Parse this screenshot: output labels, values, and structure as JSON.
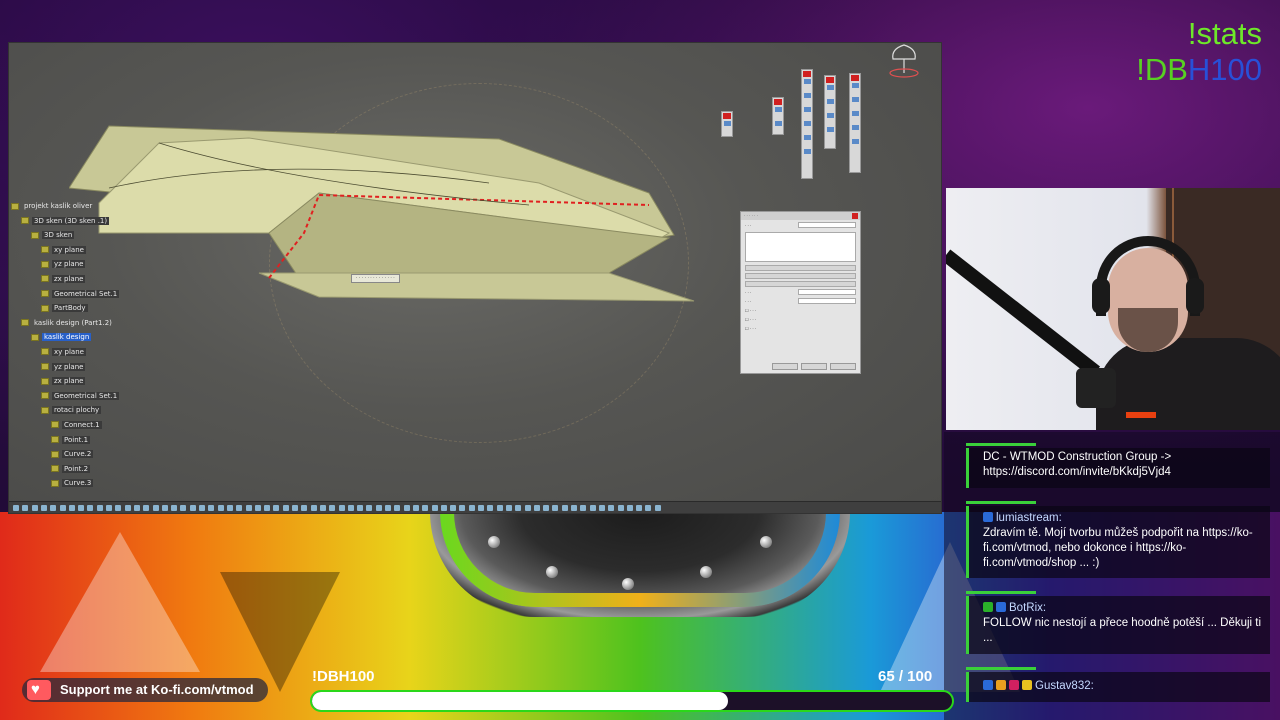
{
  "overlay": {
    "stats_line1": "!stats",
    "stats_line2_prefix": "!DB",
    "stats_line2_suffix": "H100"
  },
  "cad": {
    "tree": [
      {
        "label": "projekt kaslik oliver",
        "indent": 0,
        "style": "plain"
      },
      {
        "label": "3D sken  (3D sken .1)",
        "indent": 1,
        "style": "dark"
      },
      {
        "label": "3D sken",
        "indent": 2,
        "style": "dark"
      },
      {
        "label": "xy plane",
        "indent": 3,
        "style": "dark"
      },
      {
        "label": "yz plane",
        "indent": 3,
        "style": "dark"
      },
      {
        "label": "zx plane",
        "indent": 3,
        "style": "dark"
      },
      {
        "label": "Geometrical Set.1",
        "indent": 3,
        "style": "dark"
      },
      {
        "label": "PartBody",
        "indent": 3,
        "style": "dark"
      },
      {
        "label": "kaslik design (Part1.2)",
        "indent": 1,
        "style": "plain"
      },
      {
        "label": "kaslik design",
        "indent": 2,
        "style": "selected"
      },
      {
        "label": "xy plane",
        "indent": 3,
        "style": "dark"
      },
      {
        "label": "yz plane",
        "indent": 3,
        "style": "dark"
      },
      {
        "label": "zx plane",
        "indent": 3,
        "style": "dark"
      },
      {
        "label": "Geometrical Set.1",
        "indent": 3,
        "style": "dark"
      },
      {
        "label": "rotaci plochy",
        "indent": 3,
        "style": "dark"
      },
      {
        "label": "Connect.1",
        "indent": 4,
        "style": "dark"
      },
      {
        "label": "Point.1",
        "indent": 4,
        "style": "dark"
      },
      {
        "label": "Curve.2",
        "indent": 4,
        "style": "dark"
      },
      {
        "label": "Point.2",
        "indent": 4,
        "style": "dark"
      },
      {
        "label": "Curve.3",
        "indent": 4,
        "style": "dark"
      }
    ]
  },
  "chat": {
    "messages": [
      {
        "name": "",
        "text": "DC - WTMOD Construction Group -> https://discord.com/invite/bKkdj5Vjd4"
      },
      {
        "name": "lumiastream:",
        "text": "Zdravím tě. Mojí tvorbu můžeš podpořit na https://ko-fi.com/vtmod, nebo dokonce i https://ko-fi.com/vtmod/shop ... :)"
      },
      {
        "name": "BotRix:",
        "text": "FOLLOW nic nestojí a přece hoodně potěší ... Děkuji ti ..."
      },
      {
        "name": "Gustav832:",
        "text": ""
      }
    ]
  },
  "kofi": {
    "label": "Support me at Ko-fi.com/vtmod"
  },
  "goal": {
    "label": "!DBH100",
    "current": 65,
    "target": 100,
    "count_text": "65  / 100",
    "fill_fraction": 0.65
  },
  "colors": {
    "accent_green": "#6ee82a",
    "accent_blue": "#2850d8",
    "chat_border": "#3ad03a",
    "kofi_red": "#ff5a5f"
  }
}
